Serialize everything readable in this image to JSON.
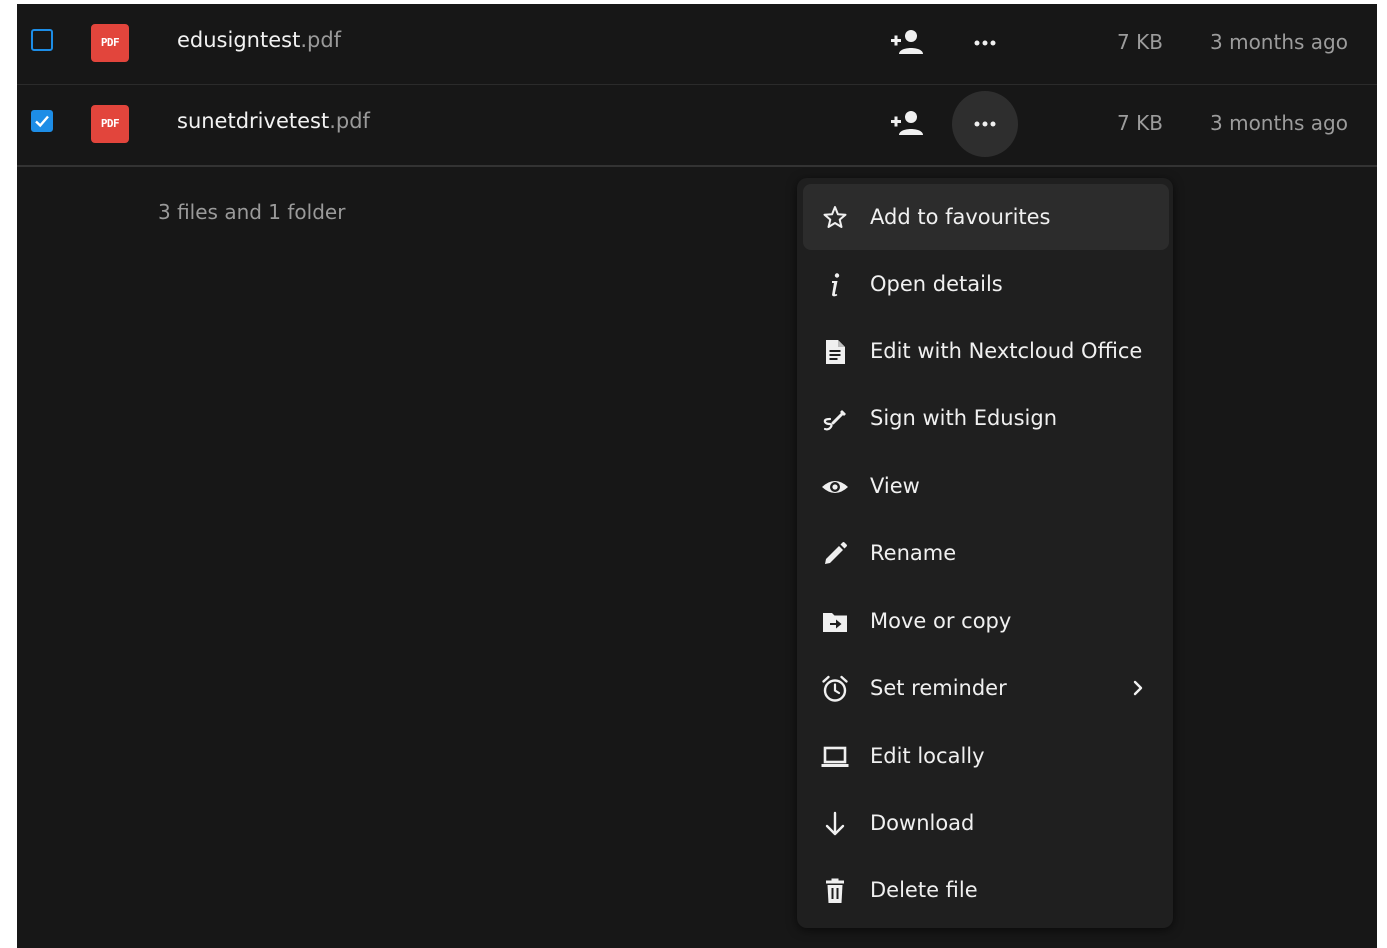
{
  "files": [
    {
      "name": "edusigntest",
      "ext": ".pdf",
      "icon_label": "PDF",
      "size": "7 KB",
      "modified": "3 months ago",
      "checked": false
    },
    {
      "name": "sunetdrivetest",
      "ext": ".pdf",
      "icon_label": "PDF",
      "size": "7 KB",
      "modified": "3 months ago",
      "checked": true
    }
  ],
  "summary": "3 files and 1 folder",
  "menu": {
    "items": [
      {
        "label": "Add to favourites",
        "icon": "star-outline-icon"
      },
      {
        "label": "Open details",
        "icon": "info-icon"
      },
      {
        "label": "Edit with Nextcloud Office",
        "icon": "document-icon"
      },
      {
        "label": "Sign with Edusign",
        "icon": "signature-icon"
      },
      {
        "label": "View",
        "icon": "eye-icon"
      },
      {
        "label": "Rename",
        "icon": "pencil-icon"
      },
      {
        "label": "Move or copy",
        "icon": "folder-move-icon"
      },
      {
        "label": "Set reminder",
        "icon": "alarm-icon"
      },
      {
        "label": "Edit locally",
        "icon": "laptop-icon"
      },
      {
        "label": "Download",
        "icon": "download-arrow-icon"
      },
      {
        "label": "Delete file",
        "icon": "trash-icon"
      }
    ]
  },
  "colors": {
    "background": "#171717",
    "menu_background": "#1f1f1f",
    "accent": "#1d8de6",
    "pdf_icon": "#e2453c",
    "muted_text": "#9c9c9c"
  }
}
